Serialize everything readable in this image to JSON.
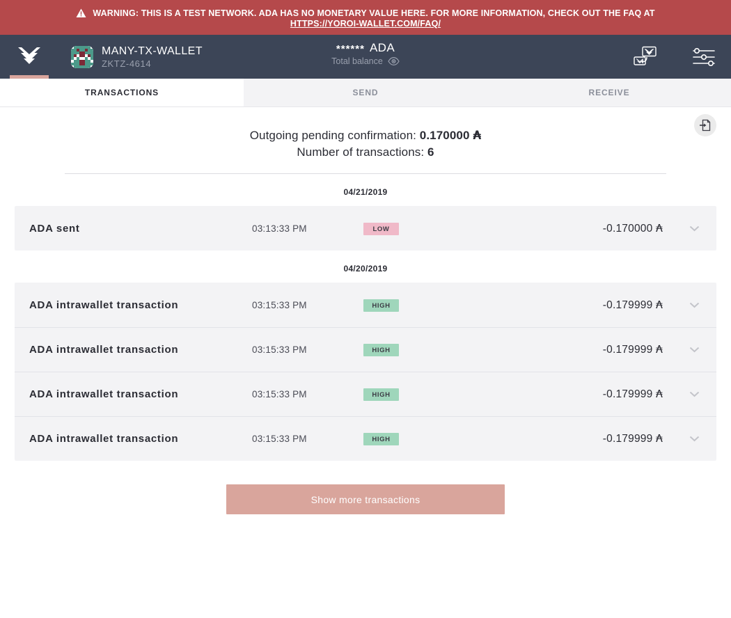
{
  "warning": {
    "icon": "warning-triangle-icon",
    "text": "WARNING: THIS IS A TEST NETWORK. ADA HAS NO MONETARY VALUE HERE. FOR MORE INFORMATION, CHECK OUT THE FAQ AT",
    "link": "HTTPS://YOROI-WALLET.COM/FAQ/",
    "bg_color": "#b5494b"
  },
  "topbar": {
    "logo_icon": "yoroi-logo-icon",
    "wallet_avatar": "wallet-identicon",
    "wallet_name": "MANY-TX-WALLET",
    "wallet_plate": "ZKTZ-4614",
    "balance_value": "******",
    "balance_currency": "ADA",
    "balance_label": "Total balance",
    "eye_icon": "eye-toggle-icon",
    "transfer_icon": "wallet-transfer-icon",
    "settings_icon": "settings-sliders-icon",
    "bg_color": "#3c4557",
    "active_indicator_color": "#d9a59c"
  },
  "tabs": [
    {
      "label": "TRANSACTIONS",
      "active": true
    },
    {
      "label": "SEND",
      "active": false
    },
    {
      "label": "RECEIVE",
      "active": false
    }
  ],
  "summary": {
    "pending_label": "Outgoing pending confirmation:",
    "pending_amount": "0.170000",
    "pending_symbol": "₳",
    "count_label": "Number of transactions:",
    "count_value": "6",
    "export_icon": "export-transactions-icon"
  },
  "transaction_groups": [
    {
      "date": "04/21/2019",
      "rows": [
        {
          "title": "ADA sent",
          "time": "03:13:33 PM",
          "badge": "LOW",
          "badge_type": "low",
          "amount": "-0.170000",
          "symbol": "₳",
          "chevron_icon": "chevron-down-icon"
        }
      ]
    },
    {
      "date": "04/20/2019",
      "rows": [
        {
          "title": "ADA intrawallet transaction",
          "time": "03:15:33 PM",
          "badge": "HIGH",
          "badge_type": "high",
          "amount": "-0.179999",
          "symbol": "₳",
          "chevron_icon": "chevron-down-icon"
        },
        {
          "title": "ADA intrawallet transaction",
          "time": "03:15:33 PM",
          "badge": "HIGH",
          "badge_type": "high",
          "amount": "-0.179999",
          "symbol": "₳",
          "chevron_icon": "chevron-down-icon"
        },
        {
          "title": "ADA intrawallet transaction",
          "time": "03:15:33 PM",
          "badge": "HIGH",
          "badge_type": "high",
          "amount": "-0.179999",
          "symbol": "₳",
          "chevron_icon": "chevron-down-icon"
        },
        {
          "title": "ADA intrawallet transaction",
          "time": "03:15:33 PM",
          "badge": "HIGH",
          "badge_type": "high",
          "amount": "-0.179999",
          "symbol": "₳",
          "chevron_icon": "chevron-down-icon"
        }
      ]
    }
  ],
  "footer": {
    "show_more_label": "Show more transactions",
    "button_color": "#d9a59c"
  },
  "colors": {
    "badge_low": "#f0b9c8",
    "badge_high": "#9fd6bb",
    "row_bg": "#f3f3f5",
    "text_dark": "#2b2c34"
  }
}
